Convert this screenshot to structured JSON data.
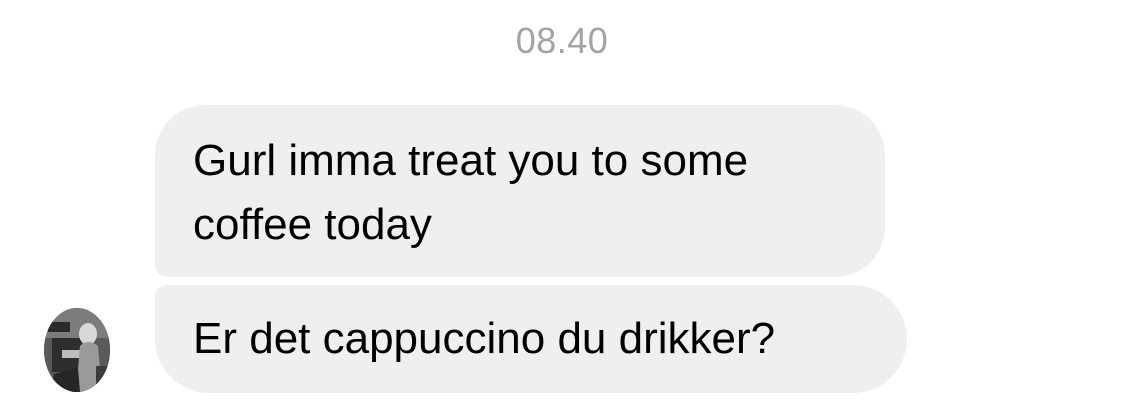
{
  "conversation": {
    "timestamp": "08.40",
    "messages": [
      {
        "text": "Gurl imma treat you to some coffee today"
      },
      {
        "text": "Er det cappuccino du drikker?"
      }
    ],
    "sender": {
      "avatar_icon": "user-avatar-photo"
    }
  },
  "colors": {
    "bubble_background": "#efefef",
    "timestamp_text": "#a3a3a3",
    "message_text": "#000000"
  }
}
